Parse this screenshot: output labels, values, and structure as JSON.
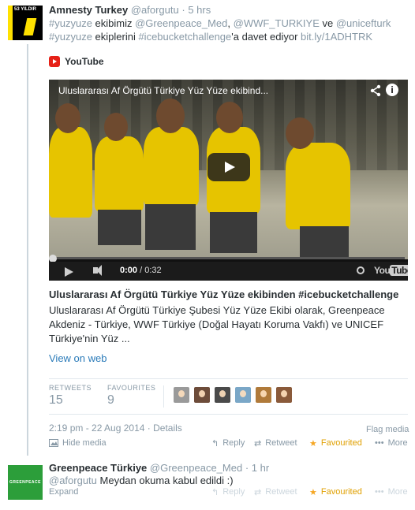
{
  "tweet1": {
    "name": "Amnesty Turkey",
    "handle": "@aforgutu",
    "time": "5 hrs",
    "text": {
      "h1": "#yuzyuze",
      "t1": " ekibimiz ",
      "m1": "@Greenpeace_Med",
      "t2": ", ",
      "m2": "@WWF_TURKIYE",
      "t3": " ve ",
      "m3": "@unicefturk",
      "h2": "#yuzyuze",
      "t4": " ekiplerini ",
      "h3": "#icebucketchallenge",
      "t5": "'a davet ediyor ",
      "link": "bit.ly/1ADHTRK"
    },
    "avatar_text": "53 YILDIR"
  },
  "card": {
    "source": "YouTube",
    "video_title": "Uluslararası Af Örgütü Türkiye Yüz Yüze ekibind...",
    "time_current": "0:00",
    "time_total": "/ 0:32",
    "yt_logo_text": "You",
    "yt_logo_tube": "Tube",
    "title": "Uluslararası Af Örgütü Türkiye Yüz Yüze ekibinden #icebucketchallenge",
    "description": "Uluslararası Af Örgütü Türkiye Şubesi Yüz Yüze Ekibi olarak, Greenpeace Akdeniz - Türkiye, WWF Türkiye (Doğal Hayatı Koruma Vakfı) ve UNICEF Türkiye'nin Yüz ...",
    "view_on_web": "View on web"
  },
  "stats": {
    "retweets_label": "RETWEETS",
    "retweets_value": "15",
    "favourites_label": "FAVOURITES",
    "favourites_value": "9"
  },
  "meta": {
    "timestamp": "2:19 pm - 22 Aug 2014",
    "separator": " · ",
    "details": "Details",
    "flag": "Flag media"
  },
  "actions1": {
    "hide_media": "Hide media",
    "reply": "Reply",
    "retweet": "Retweet",
    "favourited": "Favourited",
    "more": "More"
  },
  "tweet2": {
    "name": "Greenpeace Türkiye",
    "handle": "@Greenpeace_Med",
    "time": "1 hr",
    "mention": "@aforgutu",
    "text": " Meydan okuma kabul edildi :)",
    "avatar_text": "GREENPEACE"
  },
  "actions2": {
    "expand": "Expand",
    "reply": "Reply",
    "retweet": "Retweet",
    "favourited": "Favourited",
    "more": "More"
  },
  "icons": {
    "reply": "reply-icon",
    "retweet": "retweet-icon",
    "favourite": "star-icon",
    "more": "more-dots-icon",
    "hide_media": "image-icon"
  },
  "colors": {
    "link": "#2b7bb9",
    "muted": "#8899a6",
    "favourite": "#f5a623",
    "youtube_red": "#e62117"
  }
}
